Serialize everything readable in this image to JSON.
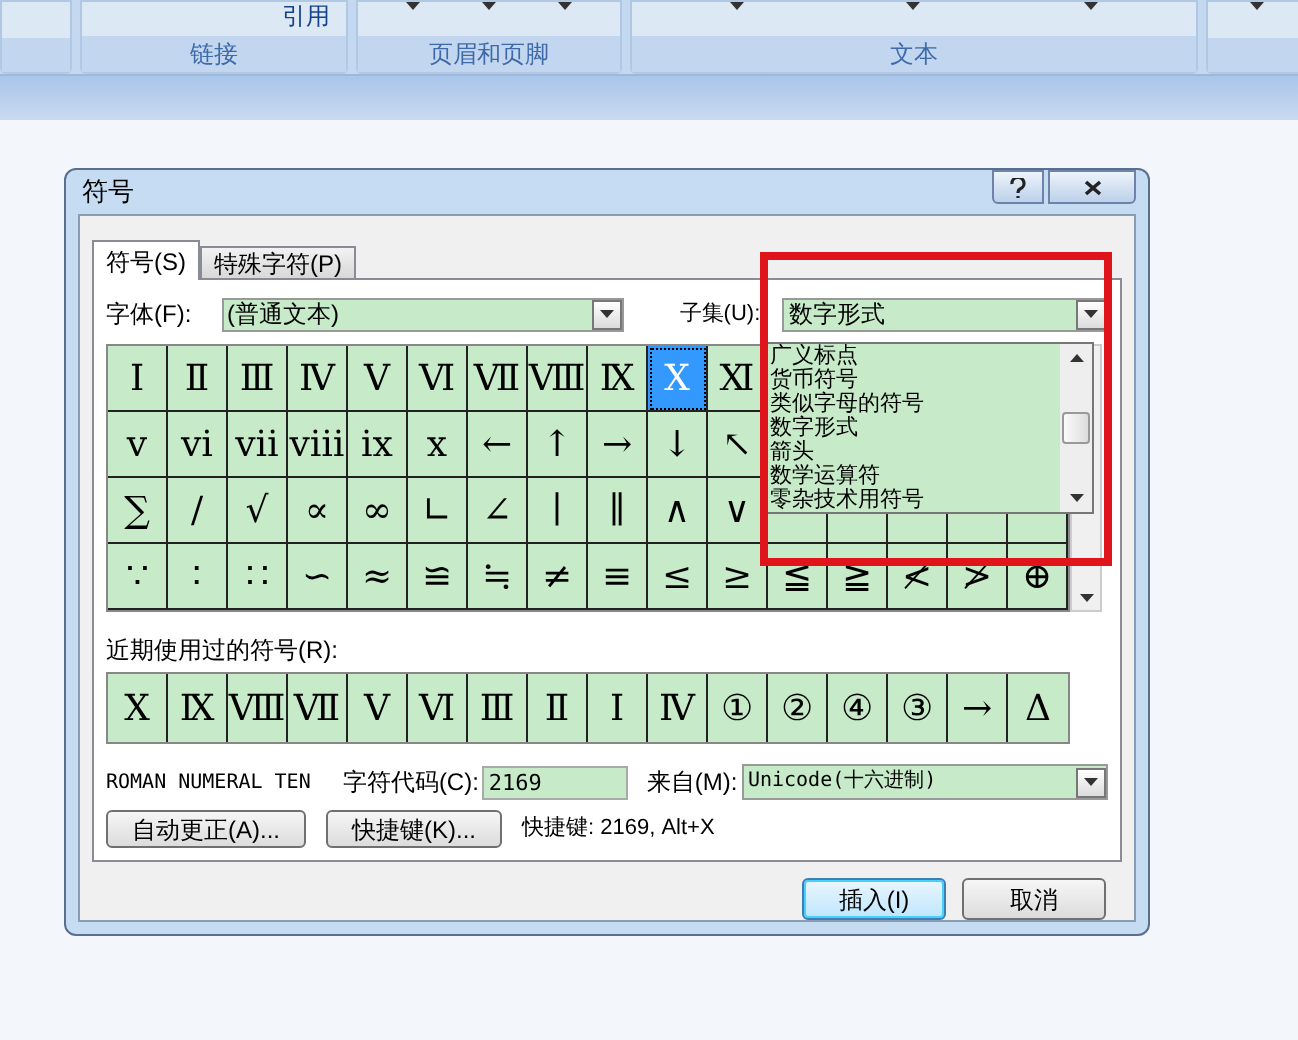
{
  "ribbon": {
    "top_button": "引用",
    "groups": [
      {
        "label": "链接"
      },
      {
        "label": "页眉和页脚"
      },
      {
        "label": "文本"
      }
    ]
  },
  "dialog": {
    "title": "符号",
    "tabs": [
      {
        "label": "符号(S)",
        "selected": true
      },
      {
        "label": "特殊字符(P)",
        "selected": false
      }
    ],
    "font_label": "字体(F):",
    "font_value": "(普通文本)",
    "subset_label": "子集(U):",
    "subset_value": "数字形式",
    "subset_options": [
      "广义标点",
      "货币符号",
      "类似字母的符号",
      "数字形式",
      "箭头",
      "数学运算符",
      "零杂技术用符号"
    ],
    "symbols": [
      [
        {
          "char": "Ⅰ",
          "selected": false
        },
        {
          "char": "Ⅱ",
          "selected": false
        },
        {
          "char": "Ⅲ",
          "selected": false
        },
        {
          "char": "Ⅳ",
          "selected": false
        },
        {
          "char": "Ⅴ",
          "selected": false
        },
        {
          "char": "Ⅵ",
          "selected": false
        },
        {
          "char": "Ⅶ",
          "selected": false
        },
        {
          "char": "Ⅷ",
          "selected": false
        },
        {
          "char": "Ⅸ",
          "selected": false
        },
        {
          "char": "Ⅹ",
          "selected": true
        },
        {
          "char": "Ⅺ",
          "selected": false
        }
      ],
      [
        {
          "char": "ⅴ",
          "selected": false
        },
        {
          "char": "ⅵ",
          "selected": false
        },
        {
          "char": "ⅶ",
          "selected": false
        },
        {
          "char": "ⅷ",
          "selected": false
        },
        {
          "char": "ⅸ",
          "selected": false
        },
        {
          "char": "ⅹ",
          "selected": false
        },
        {
          "char": "←",
          "selected": false
        },
        {
          "char": "↑",
          "selected": false
        },
        {
          "char": "→",
          "selected": false
        },
        {
          "char": "↓",
          "selected": false
        },
        {
          "char": "↖",
          "selected": false
        }
      ],
      [
        {
          "char": "∑",
          "selected": false
        },
        {
          "char": "/",
          "selected": false
        },
        {
          "char": "√",
          "selected": false
        },
        {
          "char": "∝",
          "selected": false
        },
        {
          "char": "∞",
          "selected": false
        },
        {
          "char": "∟",
          "selected": false
        },
        {
          "char": "∠",
          "selected": false
        },
        {
          "char": "∣",
          "selected": false
        },
        {
          "char": "∥",
          "selected": false
        },
        {
          "char": "∧",
          "selected": false
        },
        {
          "char": "∨",
          "selected": false
        }
      ],
      [
        {
          "char": "∵",
          "selected": false
        },
        {
          "char": "∶",
          "selected": false
        },
        {
          "char": "∷",
          "selected": false
        },
        {
          "char": "∽",
          "selected": false
        },
        {
          "char": "≈",
          "selected": false
        },
        {
          "char": "≌",
          "selected": false
        },
        {
          "char": "≒",
          "selected": false
        },
        {
          "char": "≠",
          "selected": false
        },
        {
          "char": "≡",
          "selected": false
        },
        {
          "char": "≤",
          "selected": false
        },
        {
          "char": "≥",
          "selected": false
        },
        {
          "char": "≦",
          "selected": false
        },
        {
          "char": "≧",
          "selected": false
        },
        {
          "char": "≮",
          "selected": false
        },
        {
          "char": "≯",
          "selected": false
        },
        {
          "char": "⊕",
          "selected": false
        }
      ]
    ],
    "recent_label": "近期使用过的符号(R):",
    "recent": [
      "Ⅹ",
      "Ⅸ",
      "Ⅷ",
      "Ⅶ",
      "Ⅴ",
      "Ⅵ",
      "Ⅲ",
      "Ⅱ",
      "Ⅰ",
      "Ⅳ",
      "①",
      "②",
      "④",
      "③",
      "→",
      "Δ"
    ],
    "char_name": "ROMAN NUMERAL TEN",
    "code_label": "字符代码(C):",
    "code_value": "2169",
    "from_label": "来自(M):",
    "from_value": "Unicode(十六进制)",
    "autocorrect_button": "自动更正(A)...",
    "shortcut_button": "快捷键(K)...",
    "shortcut_text": "快捷键: 2169, Alt+X",
    "insert_button": "插入(I)",
    "cancel_button": "取消"
  }
}
